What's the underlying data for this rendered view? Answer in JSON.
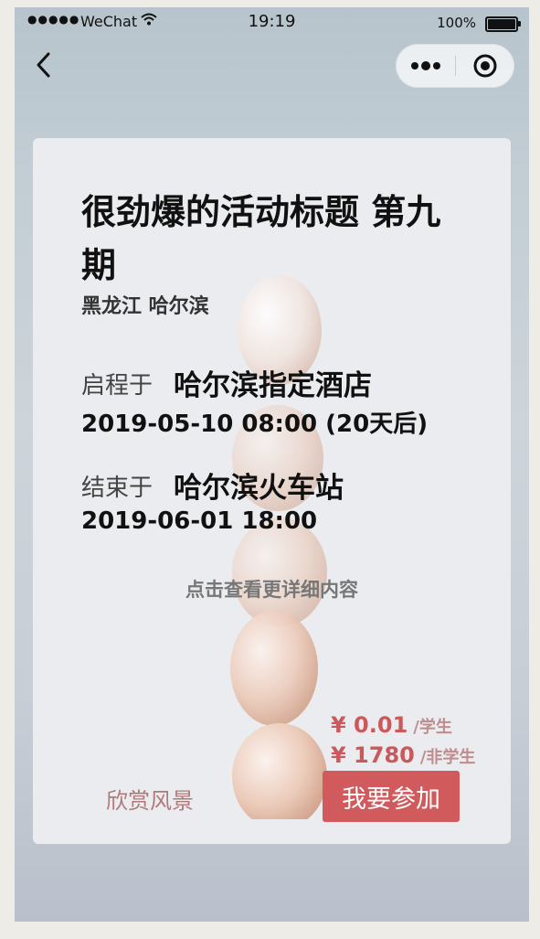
{
  "status_bar": {
    "signal": "●●●●●",
    "carrier": "WeChat",
    "time": "19:19",
    "battery_percent": "100%"
  },
  "nav": {
    "back_icon": "chevron-left-icon",
    "more_icon": "more-dots-icon",
    "close_icon": "target-circle-icon"
  },
  "event": {
    "title": "很劲爆的活动标题 第九期",
    "location": "黑龙江 哈尔滨",
    "start_prefix": "启程于",
    "start_place": "哈尔滨指定酒店",
    "start_time": "2019-05-10 08:00 (20天后)",
    "end_prefix": "结束于",
    "end_place": "哈尔滨火车站",
    "end_time": "2019-06-01 18:00",
    "detail_link": "点击查看更详细内容"
  },
  "pricing": [
    {
      "price": "¥ 0.01",
      "unit": "/学生"
    },
    {
      "price": "¥ 1780",
      "unit": "/非学生"
    }
  ],
  "actions": {
    "scenery_label": "欣赏风景",
    "join_label": "我要参加"
  },
  "colors": {
    "accent": "#d05a5c",
    "price": "#c9595b",
    "secondary_action": "#b07a7a"
  }
}
